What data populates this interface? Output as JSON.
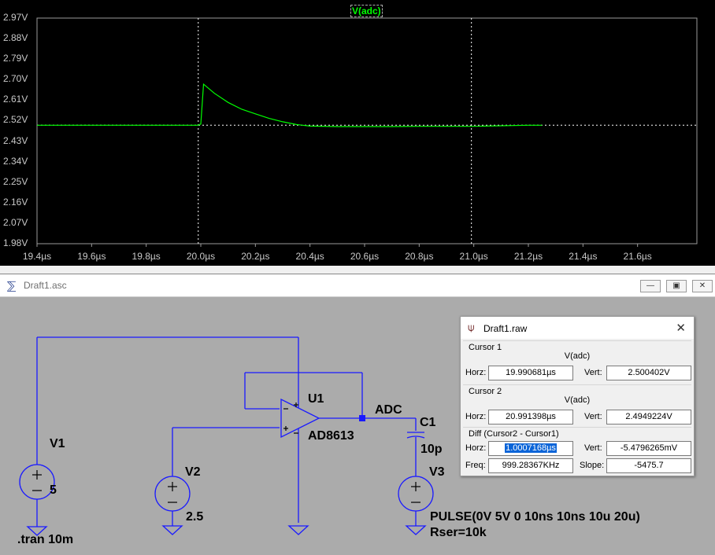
{
  "plot": {
    "trace_label": "V(adc)",
    "y_labels": [
      "2.97V",
      "2.88V",
      "2.79V",
      "2.70V",
      "2.61V",
      "2.52V",
      "2.43V",
      "2.34V",
      "2.25V",
      "2.16V",
      "2.07V",
      "1.98V"
    ],
    "x_labels": [
      "19.4µs",
      "19.6µs",
      "19.8µs",
      "20.0µs",
      "20.2µs",
      "20.4µs",
      "20.6µs",
      "20.8µs",
      "21.0µs",
      "21.2µs",
      "21.4µs",
      "21.6µs"
    ],
    "trace_color": "#00ff00",
    "cursor1_time": "19.990681µs",
    "cursor2_time": "20.991398µs"
  },
  "chart_data": {
    "type": "line",
    "title": "V(adc)",
    "xlabel": "",
    "ylabel": "",
    "xlim": [
      19.4,
      21.8
    ],
    "ylim": [
      1.98,
      2.97
    ],
    "grid": false,
    "series": [
      {
        "name": "V(adc)",
        "x": [
          19.4,
          19.6,
          19.8,
          19.99,
          20.0,
          20.01,
          20.05,
          20.1,
          20.15,
          20.2,
          20.25,
          20.3,
          20.35,
          20.4,
          20.5,
          20.6,
          20.7,
          20.8,
          20.9,
          21.0,
          21.2,
          21.25
        ],
        "y": [
          2.5,
          2.5,
          2.5,
          2.5,
          2.505,
          2.68,
          2.64,
          2.6,
          2.57,
          2.55,
          2.53,
          2.515,
          2.503,
          2.496,
          2.494,
          2.494,
          2.494,
          2.495,
          2.495,
          2.495,
          2.5,
          2.5
        ]
      }
    ]
  },
  "schematic_window": {
    "title": "Draft1.asc",
    "labels": {
      "v1": "V1",
      "v1_val": "5",
      "v2": "V2",
      "v2_val": "2.5",
      "v3": "V3",
      "v3_src": "PULSE(0V 5V 0 10ns 10ns 10u 20u)",
      "v3_rser": "Rser=10k",
      "u1": "U1",
      "u1_part": "AD8613",
      "c1": "C1",
      "c1_val": "10p",
      "net": "ADC",
      "directive": ".tran 10m"
    }
  },
  "cursor_dialog": {
    "title": "Draft1.raw",
    "cursor1": {
      "title": "Cursor 1",
      "signal": "V(adc)",
      "horz": "19.990681µs",
      "vert": "2.500402V"
    },
    "cursor2": {
      "title": "Cursor 2",
      "signal": "V(adc)",
      "horz": "20.991398µs",
      "vert": "2.4949224V"
    },
    "diff": {
      "title": "Diff (Cursor2 - Cursor1)",
      "horz": "1.0007168µs",
      "vert": "-5.4796265mV",
      "freq": "999.28367KHz",
      "slope": "-5475.7"
    },
    "labels": {
      "horz": "Horz:",
      "vert": "Vert:",
      "freq": "Freq:",
      "slope": "Slope:"
    }
  }
}
